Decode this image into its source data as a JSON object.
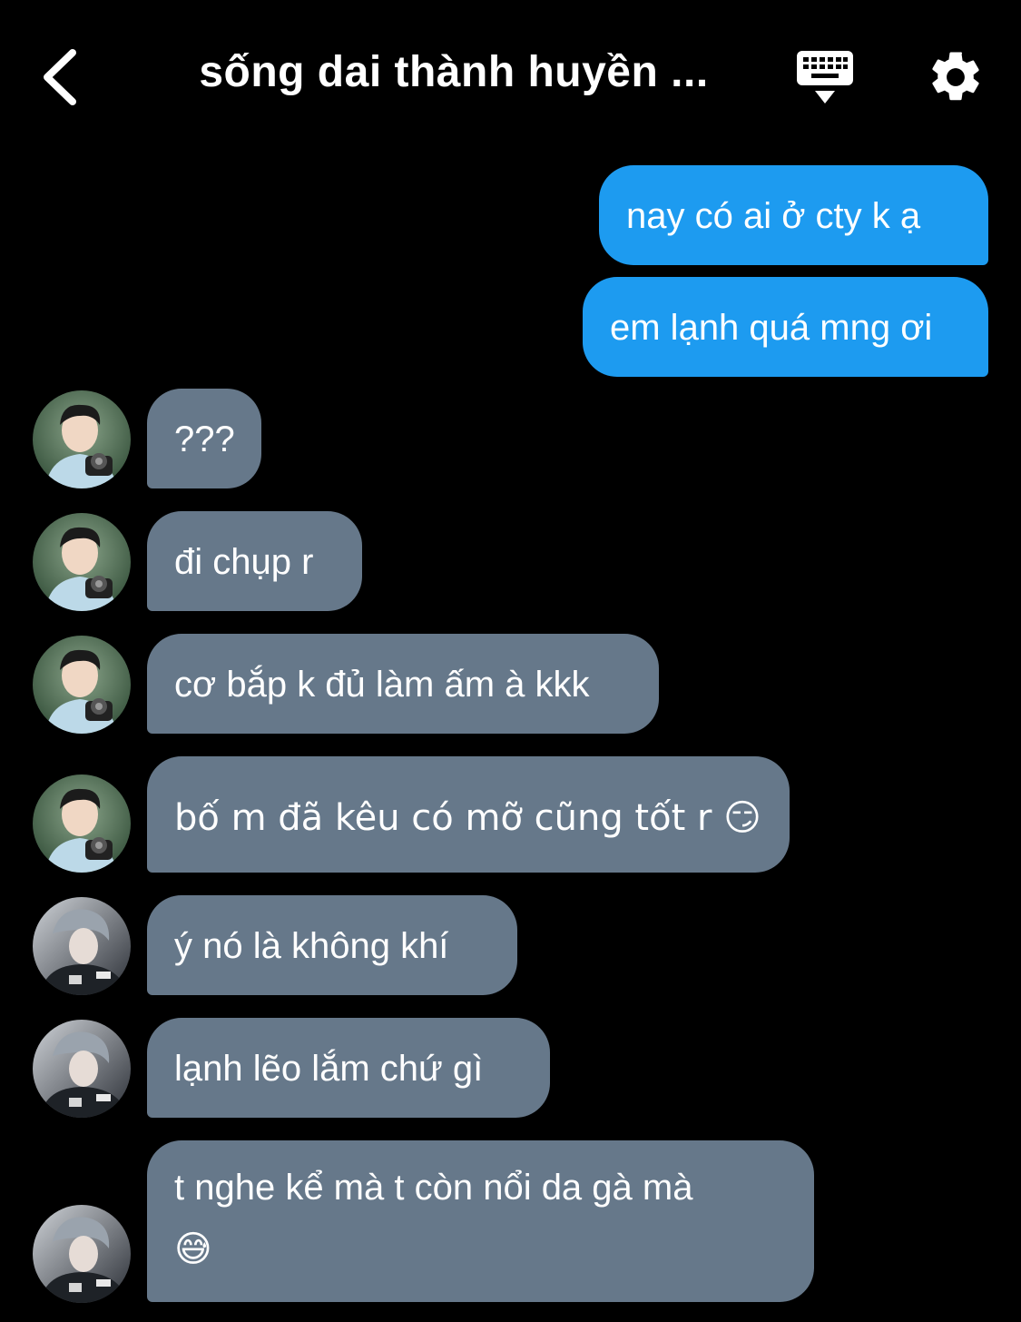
{
  "header": {
    "title": "sống dai thành huyền ...",
    "icons": {
      "back": "chevron-left-icon",
      "keyboard": "keyboard-icon",
      "settings": "gear-icon"
    }
  },
  "colors": {
    "background": "#000000",
    "outgoing_bubble": "#1d9bf0",
    "incoming_bubble": "#66788a"
  },
  "messages": [
    {
      "direction": "outgoing",
      "text": "nay có ai ở cty k ạ"
    },
    {
      "direction": "outgoing",
      "text": "em lạnh quá mng ơi"
    },
    {
      "direction": "incoming",
      "text": "???",
      "sender_avatar": "avatar-user-a"
    },
    {
      "direction": "incoming",
      "text": "đi chụp r",
      "sender_avatar": "avatar-user-a"
    },
    {
      "direction": "incoming",
      "text": "cơ bắp k đủ làm ấm à kkk",
      "sender_avatar": "avatar-user-a"
    },
    {
      "direction": "incoming",
      "text": "bố m đã kêu có mỡ cũng tốt r 😏",
      "sender_avatar": "avatar-user-a"
    },
    {
      "direction": "incoming",
      "text": "ý nó là không khí",
      "sender_avatar": "avatar-user-b"
    },
    {
      "direction": "incoming",
      "text": "lạnh lẽo lắm chứ gì",
      "sender_avatar": "avatar-user-b"
    },
    {
      "direction": "incoming",
      "text": "t nghe kể mà t còn nổi da gà mà",
      "text_line2": "😅",
      "sender_avatar": "avatar-user-b"
    }
  ]
}
